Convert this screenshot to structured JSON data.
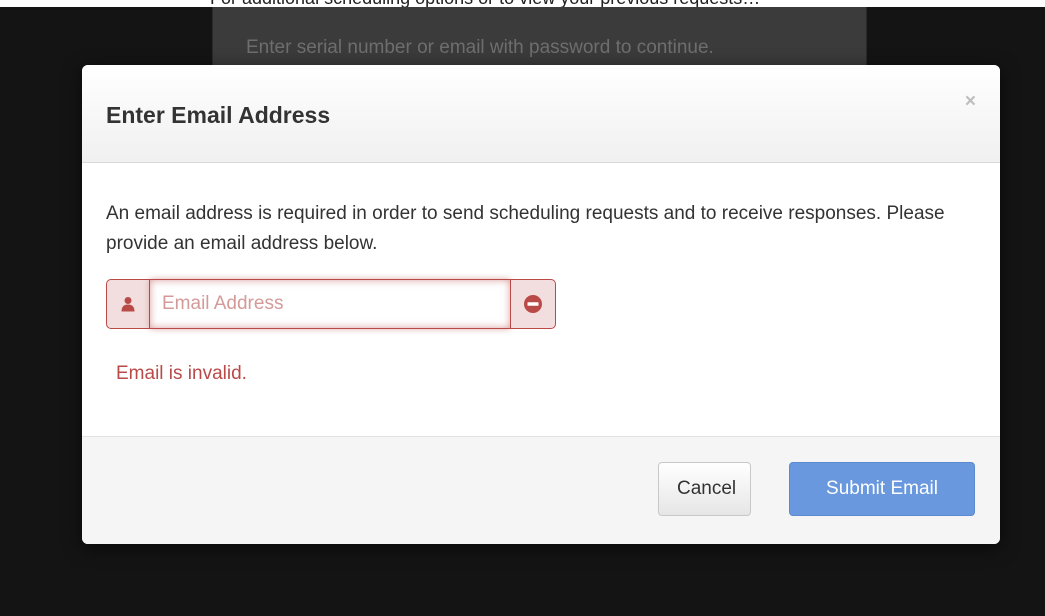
{
  "background": {
    "top_strip_text": "For additional scheduling options or to view your previous requests…",
    "panel_text": "Enter serial number or email with password to continue."
  },
  "modal": {
    "title": "Enter Email Address",
    "close_glyph": "×",
    "description": "An email address is required in order to send scheduling requests and to receive responses. Please provide an email address below.",
    "email_field": {
      "placeholder": "Email Address",
      "value": ""
    },
    "error_message": "Email is invalid.",
    "buttons": {
      "cancel_label": "Cancel",
      "submit_label": "Submit Email"
    }
  },
  "icons": {
    "left_addon": "user-icon",
    "right_addon": "minus-circle-icon"
  },
  "colors": {
    "error": "#b94a48",
    "error_bg": "#f2dede",
    "primary": "#5a8fdc",
    "backdrop": "#141414"
  }
}
